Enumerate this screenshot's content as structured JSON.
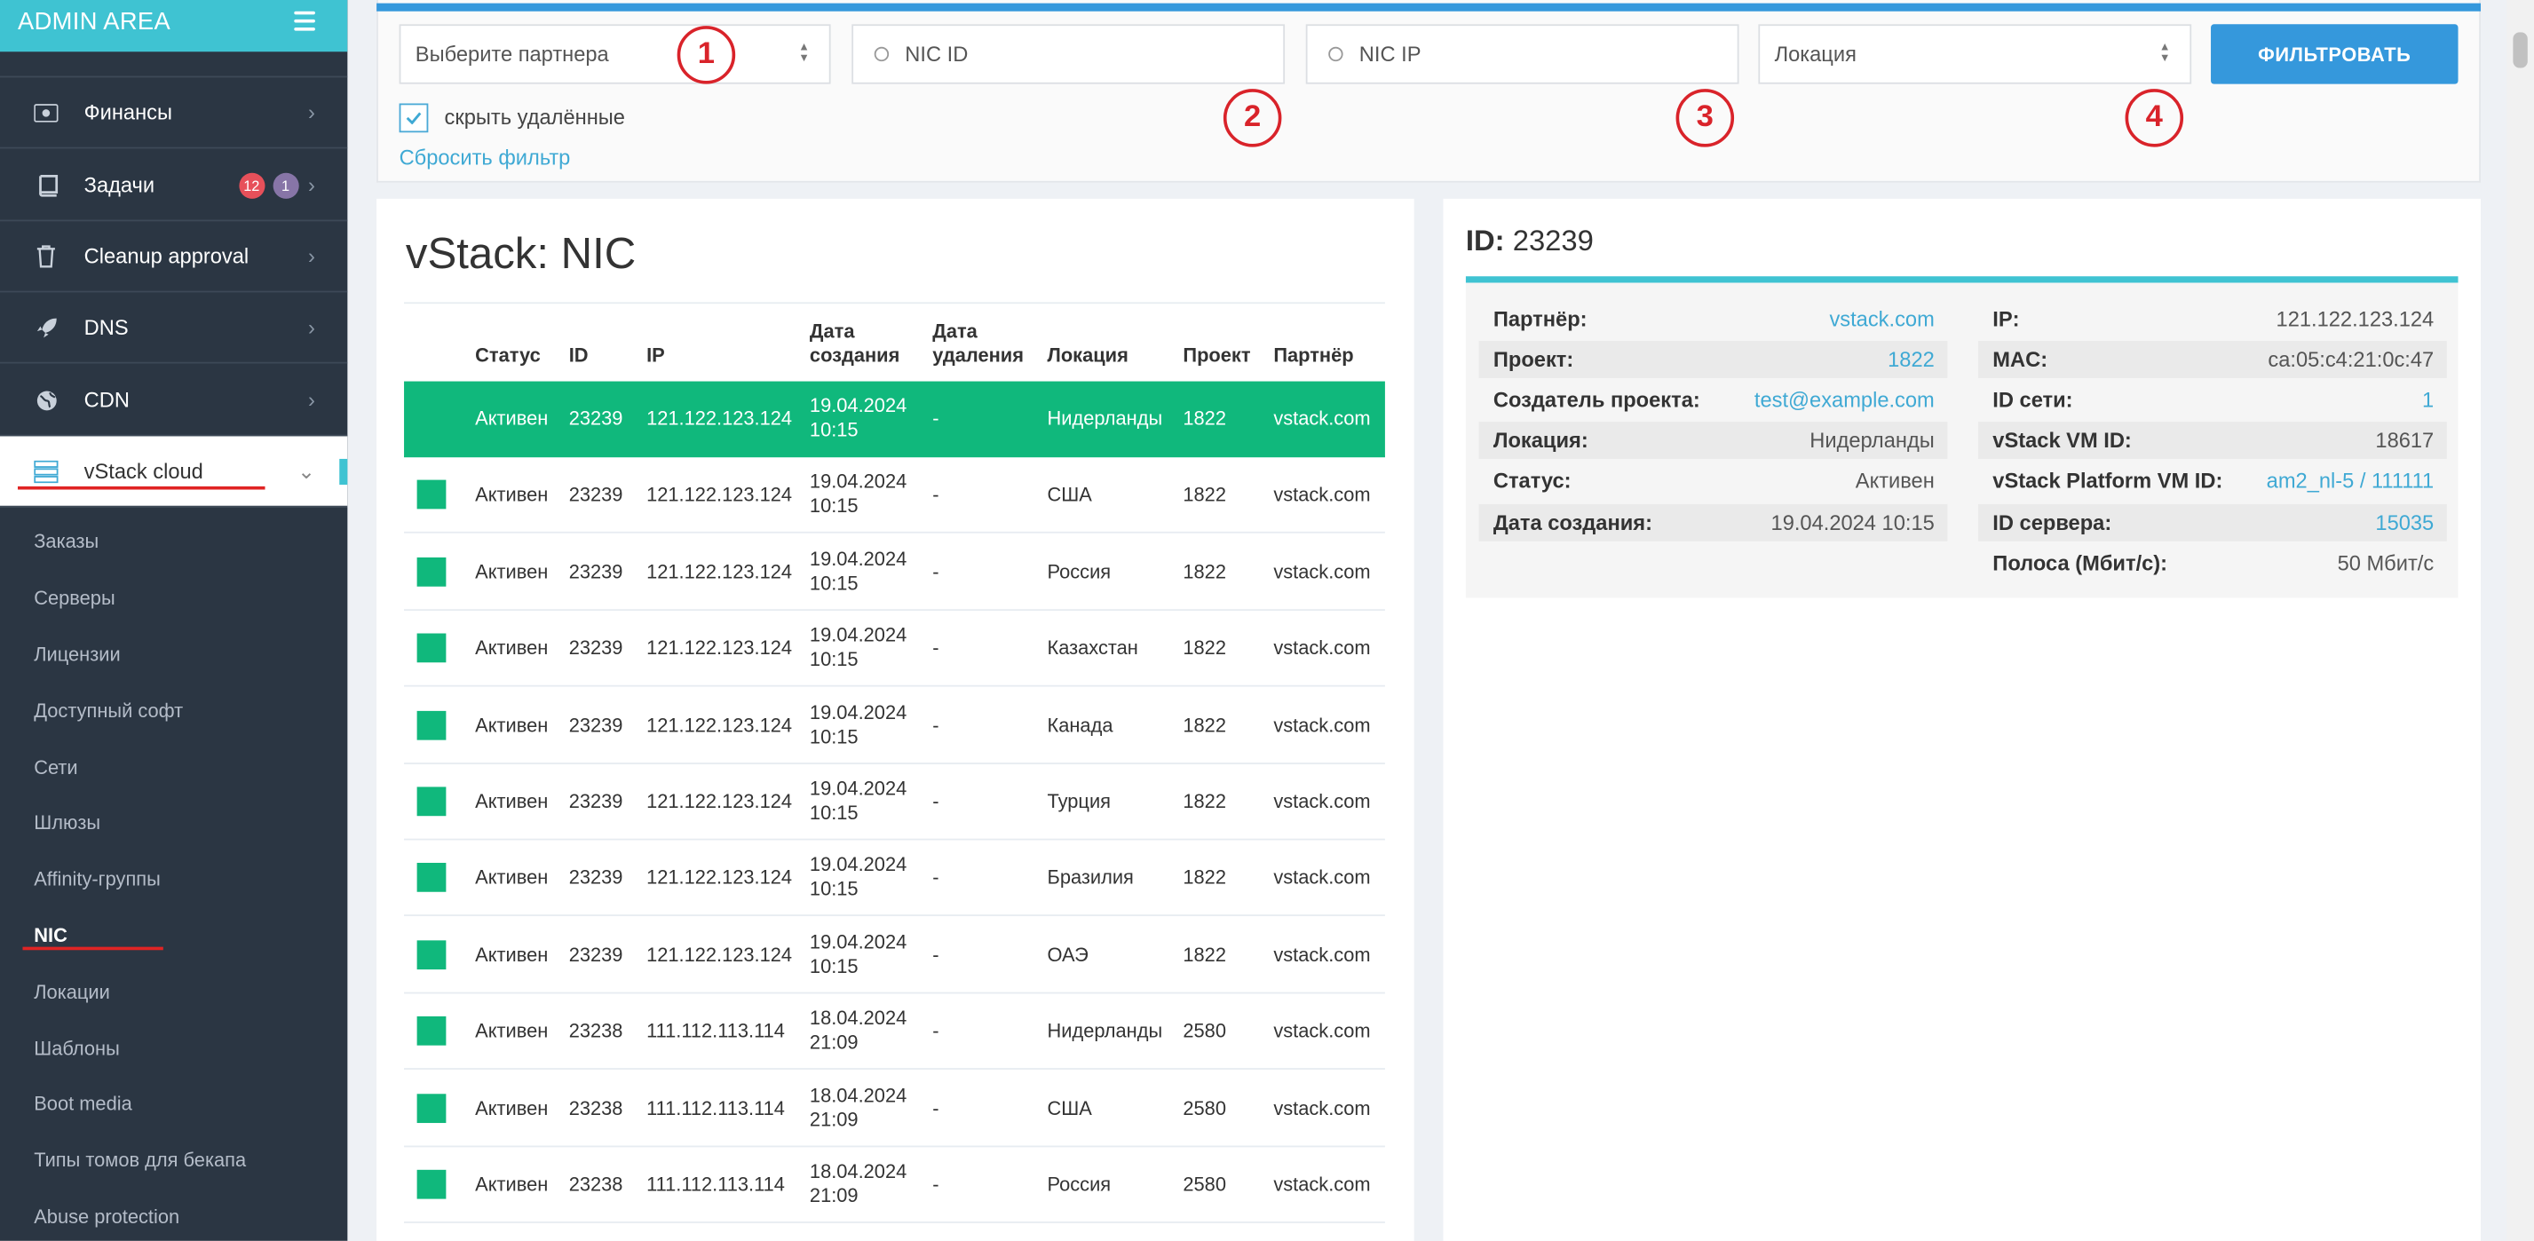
{
  "sidebar": {
    "brand": "ADMIN AREA",
    "items": [
      {
        "label": "Финансы",
        "icon": "money-icon"
      },
      {
        "label": "Задачи",
        "icon": "book-icon",
        "badges": [
          "12",
          "1"
        ]
      },
      {
        "label": "Cleanup approval",
        "icon": "trash-icon"
      },
      {
        "label": "DNS",
        "icon": "rocket-icon"
      },
      {
        "label": "CDN",
        "icon": "globe-icon"
      },
      {
        "label": "vStack cloud",
        "icon": "server-icon"
      }
    ],
    "subitems": [
      "Заказы",
      "Серверы",
      "Лицензии",
      "Доступный софт",
      "Сети",
      "Шлюзы",
      "Affinity-группы",
      "NIC",
      "Локации",
      "Шаблоны",
      "Boot media",
      "Типы томов для бекапа",
      "Abuse protection"
    ]
  },
  "filter": {
    "partner_placeholder": "Выберите партнера",
    "nic_id_placeholder": "NIC ID",
    "nic_ip_placeholder": "NIC IP",
    "location_placeholder": "Локация",
    "submit": "ФИЛЬТРОВАТЬ",
    "hide_deleted": "скрыть удалённые",
    "reset": "Сбросить фильтр",
    "annotations": [
      "1",
      "2",
      "3",
      "4"
    ]
  },
  "table": {
    "title": "vStack: NIC",
    "columns": {
      "status": "Статус",
      "id": "ID",
      "ip": "IP",
      "created_1": "Дата",
      "created_2": "создания",
      "deleted_1": "Дата",
      "deleted_2": "удаления",
      "location": "Локация",
      "project": "Проект",
      "partner": "Партнёр"
    },
    "rows": [
      {
        "status": "Активен",
        "id": "23239",
        "ip": "121.122.123.124",
        "date": "19.04.2024",
        "time": "10:15",
        "deleted": "-",
        "location": "Нидерланды",
        "project": "1822",
        "partner": "vstack.com"
      },
      {
        "status": "Активен",
        "id": "23239",
        "ip": "121.122.123.124",
        "date": "19.04.2024",
        "time": "10:15",
        "deleted": "-",
        "location": "США",
        "project": "1822",
        "partner": "vstack.com"
      },
      {
        "status": "Активен",
        "id": "23239",
        "ip": "121.122.123.124",
        "date": "19.04.2024",
        "time": "10:15",
        "deleted": "-",
        "location": "Россия",
        "project": "1822",
        "partner": "vstack.com"
      },
      {
        "status": "Активен",
        "id": "23239",
        "ip": "121.122.123.124",
        "date": "19.04.2024",
        "time": "10:15",
        "deleted": "-",
        "location": "Казахстан",
        "project": "1822",
        "partner": "vstack.com"
      },
      {
        "status": "Активен",
        "id": "23239",
        "ip": "121.122.123.124",
        "date": "19.04.2024",
        "time": "10:15",
        "deleted": "-",
        "location": "Канада",
        "project": "1822",
        "partner": "vstack.com"
      },
      {
        "status": "Активен",
        "id": "23239",
        "ip": "121.122.123.124",
        "date": "19.04.2024",
        "time": "10:15",
        "deleted": "-",
        "location": "Турция",
        "project": "1822",
        "partner": "vstack.com"
      },
      {
        "status": "Активен",
        "id": "23239",
        "ip": "121.122.123.124",
        "date": "19.04.2024",
        "time": "10:15",
        "deleted": "-",
        "location": "Бразилия",
        "project": "1822",
        "partner": "vstack.com"
      },
      {
        "status": "Активен",
        "id": "23239",
        "ip": "121.122.123.124",
        "date": "19.04.2024",
        "time": "10:15",
        "deleted": "-",
        "location": "ОАЭ",
        "project": "1822",
        "partner": "vstack.com"
      },
      {
        "status": "Активен",
        "id": "23238",
        "ip": "111.112.113.114",
        "date": "18.04.2024",
        "time": "21:09",
        "deleted": "-",
        "location": "Нидерланды",
        "project": "2580",
        "partner": "vstack.com"
      },
      {
        "status": "Активен",
        "id": "23238",
        "ip": "111.112.113.114",
        "date": "18.04.2024",
        "time": "21:09",
        "deleted": "-",
        "location": "США",
        "project": "2580",
        "partner": "vstack.com"
      },
      {
        "status": "Активен",
        "id": "23238",
        "ip": "111.112.113.114",
        "date": "18.04.2024",
        "time": "21:09",
        "deleted": "-",
        "location": "Россия",
        "project": "2580",
        "partner": "vstack.com"
      }
    ]
  },
  "detail": {
    "id_label": "ID:",
    "id_value": "23239",
    "left": [
      {
        "k": "Партнёр:",
        "v": "vstack.com",
        "link": true
      },
      {
        "k": "Проект:",
        "v": "1822",
        "link": true
      },
      {
        "k": "Создатель проекта:",
        "v": "test@example.com",
        "link": true
      },
      {
        "k": "Локация:",
        "v": "Нидерланды",
        "link": false
      },
      {
        "k": "Статус:",
        "v": "Активен",
        "link": false
      },
      {
        "k": "Дата создания:",
        "v": "19.04.2024 10:15",
        "link": false
      }
    ],
    "right": [
      {
        "k": "IP:",
        "v": "121.122.123.124",
        "link": false
      },
      {
        "k": "MAC:",
        "v": "ca:05:c4:21:0c:47",
        "link": false
      },
      {
        "k": "ID сети:",
        "v": "1",
        "link": true
      },
      {
        "k": "vStack VM ID:",
        "v": "18617",
        "link": false
      },
      {
        "k": "vStack Platform VM ID:",
        "v": "am2_nl-5 / 111111",
        "link": true
      },
      {
        "k": "ID сервера:",
        "v": "15035",
        "link": true
      },
      {
        "k": "Полоса (Мбит/с):",
        "v": "50 Мбит/с",
        "link": false
      }
    ]
  },
  "colors": {
    "accent": "#3fc3d2",
    "primary": "#3598dc",
    "success": "#10b87c",
    "annotation": "#d9232a",
    "sidebar": "#2b3643"
  }
}
